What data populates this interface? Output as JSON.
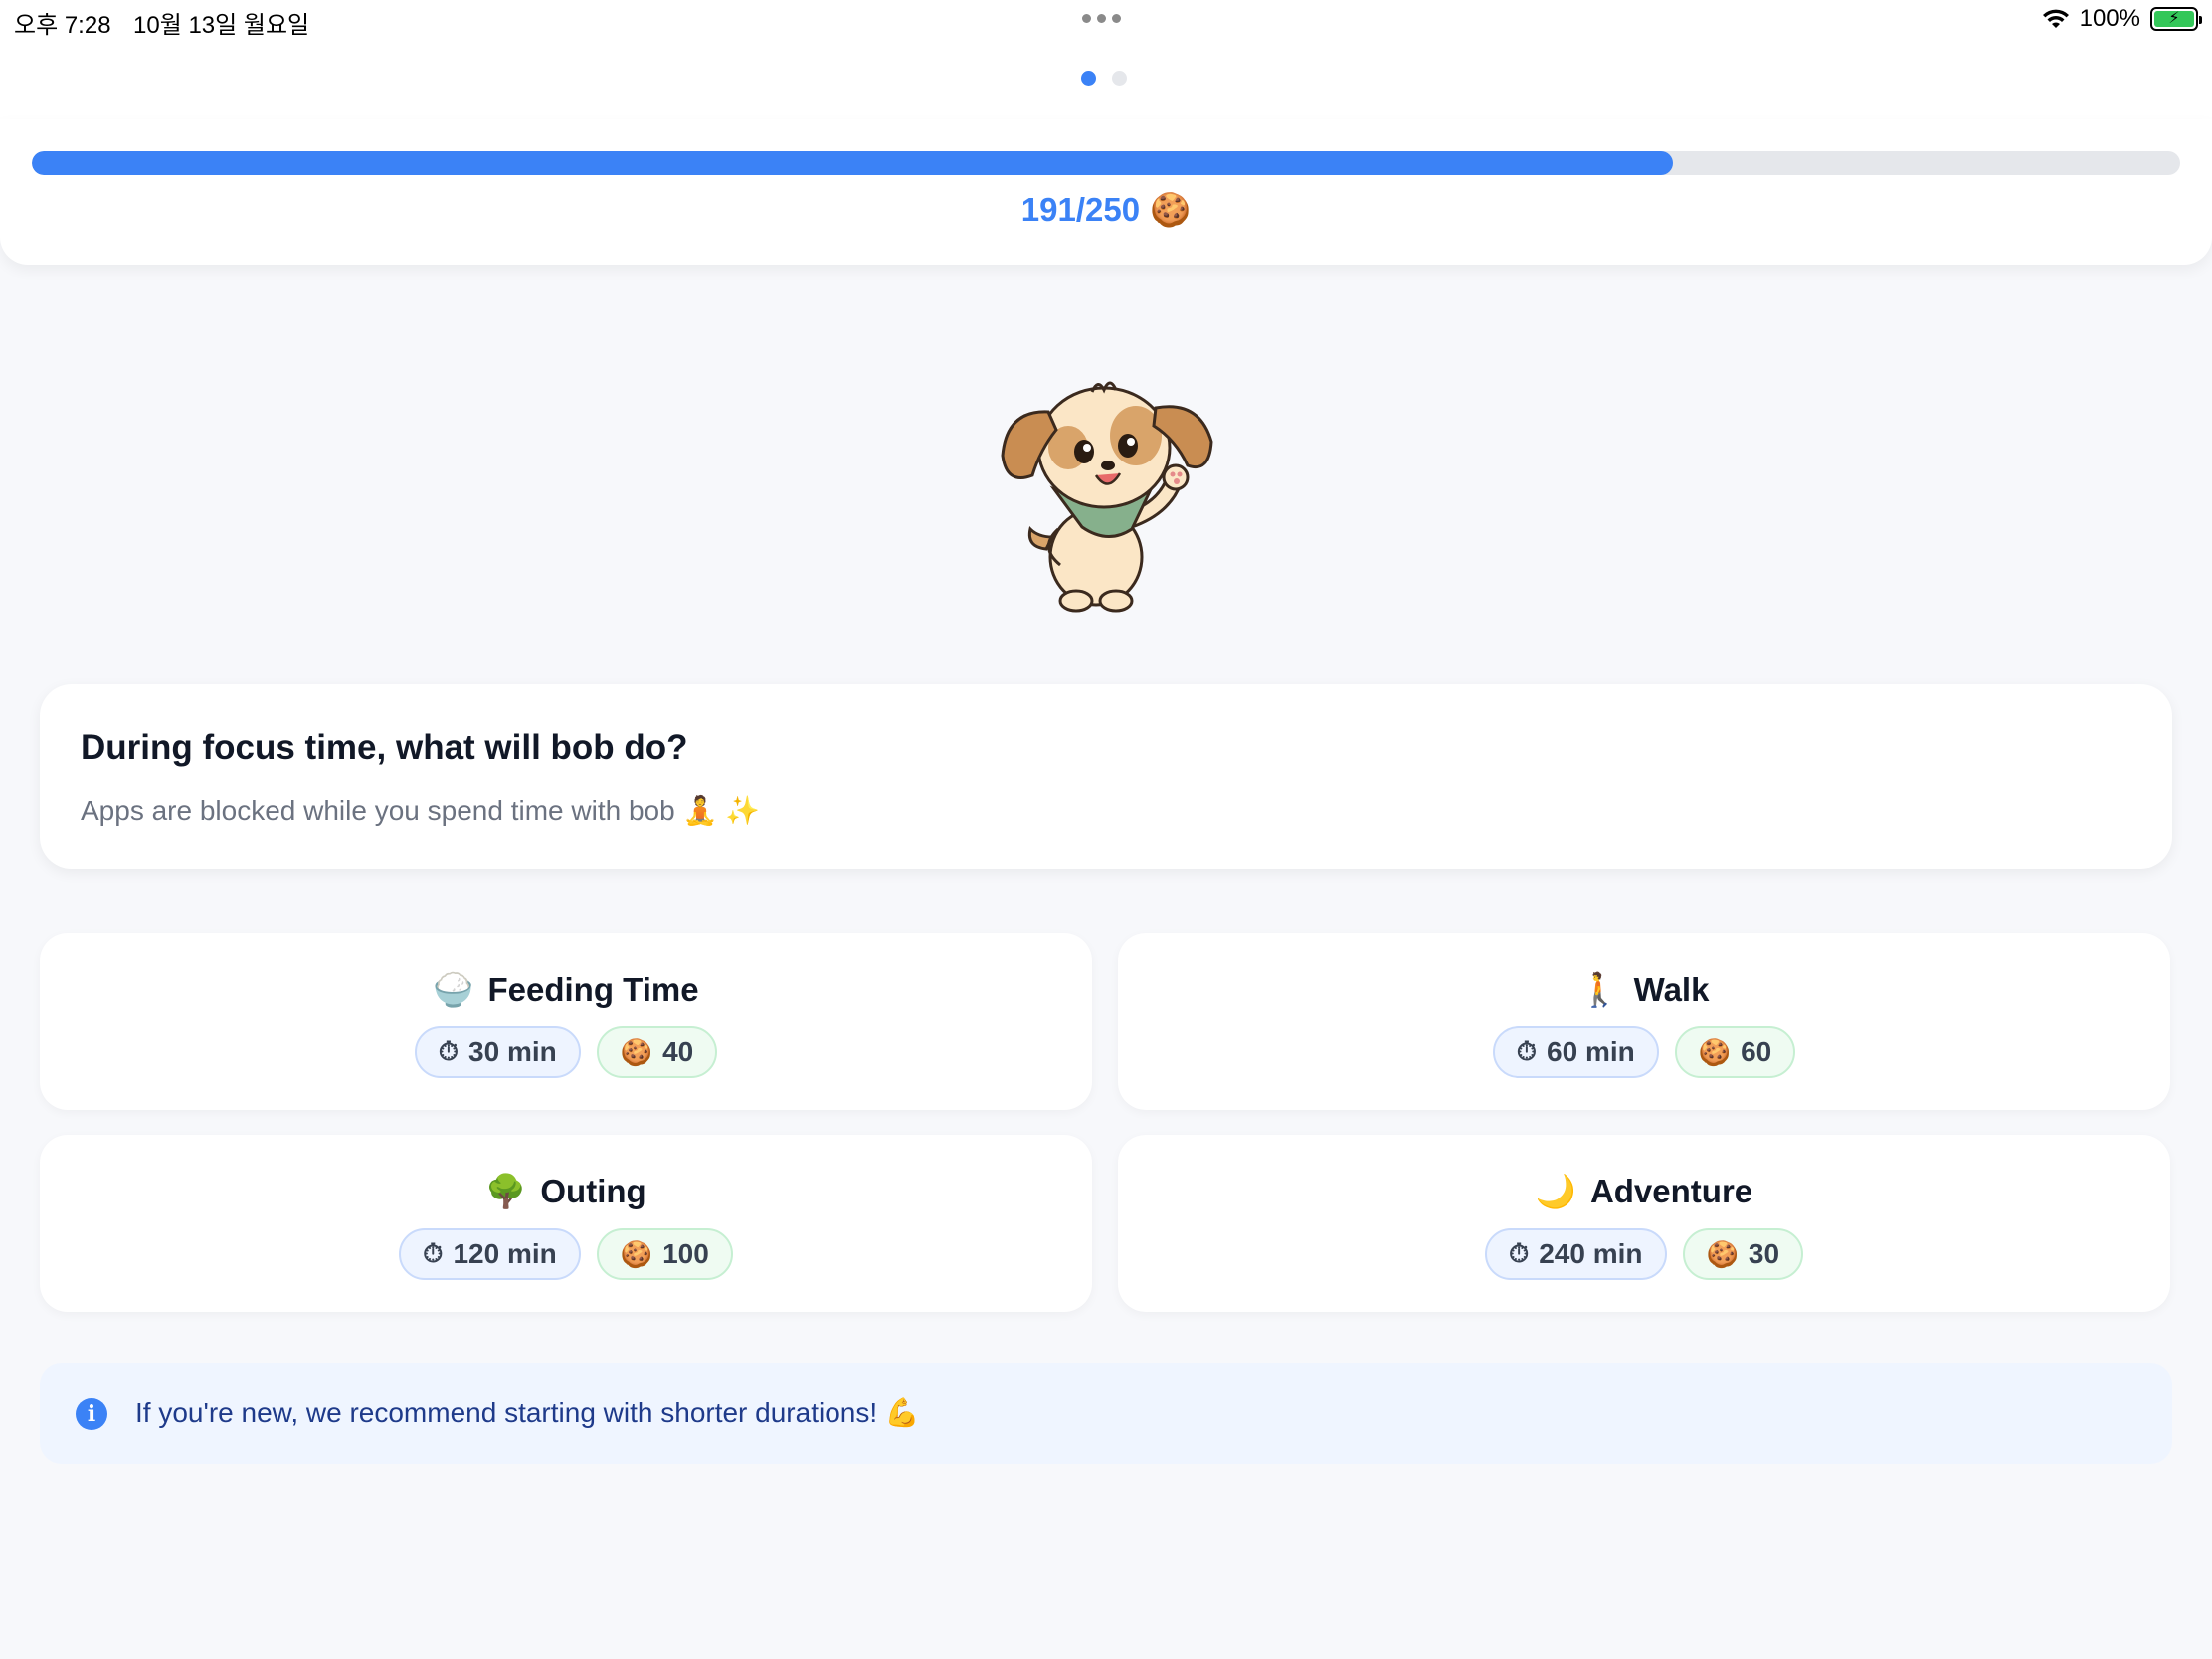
{
  "status_bar": {
    "time": "오후 7:28",
    "date": "10월 13일 월요일",
    "battery": "100%",
    "wifi_icon": "wifi-icon",
    "battery_icon": "battery-charging-icon"
  },
  "pager": {
    "pages": 2,
    "active_index": 0
  },
  "progress": {
    "current": 191,
    "max": 250,
    "label": "191/250",
    "icon": "🍪",
    "fill_color": "#3b82f6"
  },
  "pet": {
    "name": "bob",
    "image": "puppy-with-green-bandana"
  },
  "prompt": {
    "title": "During focus time, what will bob do?",
    "subtitle": "Apps are blocked while you spend time with bob 🧘 ✨"
  },
  "activities": [
    {
      "emoji": "🍚",
      "title": "Feeding Time",
      "duration": "30 min",
      "reward": "40"
    },
    {
      "emoji": "🚶",
      "title": "Walk",
      "duration": "60 min",
      "reward": "60"
    },
    {
      "emoji": "🌳",
      "title": "Outing",
      "duration": "120 min",
      "reward": "100"
    },
    {
      "emoji": "🌙",
      "title": "Adventure",
      "duration": "240 min",
      "reward": "30"
    }
  ],
  "chip_icons": {
    "time": "⏱",
    "reward": "🍪"
  },
  "info": {
    "icon": "i",
    "text": "If you're new, we recommend starting with shorter durations! 💪"
  }
}
